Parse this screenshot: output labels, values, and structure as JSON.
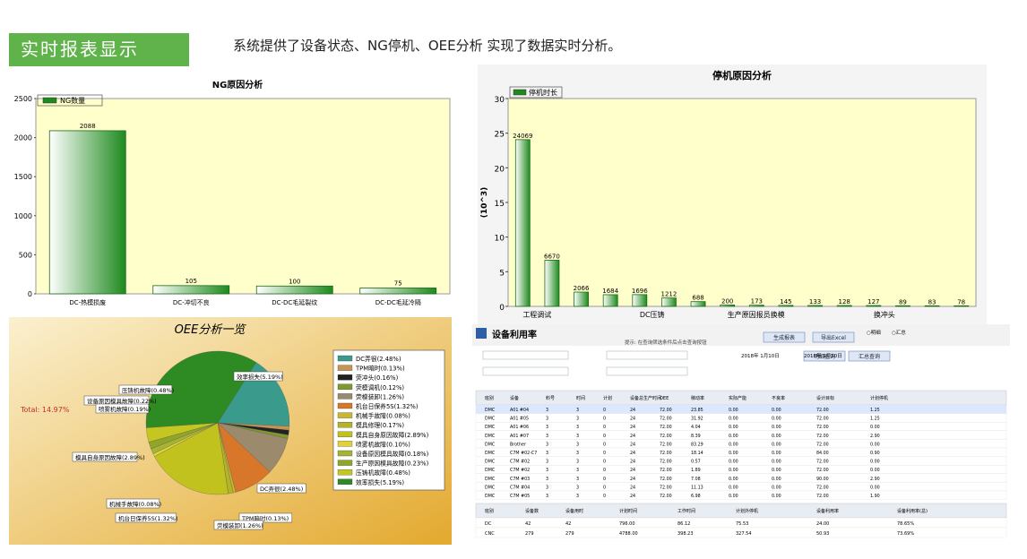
{
  "header": {
    "banner": "实时报表显示",
    "subtitle": "系统提供了设备状态、NG停机、OEE分析 实现了数据实时分析。"
  },
  "colors": {
    "banner": "#5fb34a",
    "bar_dark": "#1e8a1e",
    "bar_light": "#ffffff",
    "plot_bg": "#ffffcc",
    "oee_bg": "#e9c266"
  },
  "chart_data": [
    {
      "type": "bar",
      "title": "NG原因分析",
      "legend": [
        "NG数量"
      ],
      "categories": [
        "DC-热模损废",
        "DC-冲切不良",
        "DC-DC毛延裂纹",
        "DC-DC毛延冷隔"
      ],
      "values": [
        2088,
        105,
        100,
        75
      ],
      "ylim": [
        0,
        2500
      ],
      "yticks": [
        "0",
        "500",
        "1000",
        "1500",
        "2000",
        "2500"
      ],
      "grid": false
    },
    {
      "type": "bar",
      "title": "停机原因分析",
      "legend": [
        "停机时长"
      ],
      "ylabel": "(10^3)",
      "categories": [
        "工程调试",
        "",
        "",
        "",
        "DC压铸",
        "",
        "",
        "生产原因报员换模",
        "",
        "",
        "",
        "",
        "换冲头",
        "",
        "",
        ""
      ],
      "values": [
        24.069,
        6.67,
        2.066,
        1.684,
        1.696,
        1.212,
        0.688,
        0.2,
        0.173,
        0.145,
        0.133,
        0.128,
        0.127,
        0.089,
        0.083,
        0.078
      ],
      "data_labels": [
        "24069",
        "6670",
        "2066",
        "1684",
        "1696",
        "1212",
        "688",
        "200",
        "173",
        "145",
        "133",
        "128",
        "127",
        "89",
        "83",
        "78"
      ],
      "ylim": [
        0,
        30
      ],
      "yticks": [
        "0",
        "5",
        "10",
        "15",
        "20",
        "25",
        "30"
      ],
      "grid": false
    },
    {
      "type": "pie",
      "title": "OEE分析一览",
      "total_label": "Total: 14.97%",
      "slices": [
        {
          "name": "DC弄很",
          "label": "DC弄很(2.48%)",
          "value": 2.48,
          "color": "#3a9a8c"
        },
        {
          "name": "TPM暗时",
          "label": "TPM暗时(0.13%)",
          "value": 0.13,
          "color": "#c99450"
        },
        {
          "name": "荧冲头",
          "label": "荧冲头(0.16%)",
          "value": 0.16,
          "color": "#222222"
        },
        {
          "name": "荧模调机",
          "label": "荧模调机(0.12%)",
          "value": 0.12,
          "color": "#7d9a2a"
        },
        {
          "name": "荧模装卸",
          "label": "荧模装卸(1.26%)",
          "value": 1.26,
          "color": "#9c8a6c"
        },
        {
          "name": "机台日保养5S",
          "label": "机台日保养5S(1.32%)",
          "value": 1.32,
          "color": "#d8762a"
        },
        {
          "name": "机械手故障",
          "label": "机械手故障(0.08%)",
          "value": 0.08,
          "color": "#c8b830"
        },
        {
          "name": "模具修理",
          "label": "模具修理(0.17%)",
          "value": 0.17,
          "color": "#b3b32a"
        },
        {
          "name": "模具自身原因故障",
          "label": "模具自身原因故障(2.89%)",
          "value": 2.89,
          "color": "#c2c21e"
        },
        {
          "name": "喷雾机故障",
          "label": "喷雾机故障(0.10%)",
          "value": 0.1,
          "color": "#e2d23a"
        },
        {
          "name": "设备原因模具故障",
          "label": "设备原因模具故障(0.18%)",
          "value": 0.18,
          "color": "#a7b432"
        },
        {
          "name": "生产原因模具故障",
          "label": "生产原因模具故障(0.23%)",
          "value": 0.23,
          "color": "#8fa628"
        },
        {
          "name": "压铸机故障",
          "label": "压铸机故障(0.48%)",
          "value": 0.48,
          "color": "#c6c620"
        },
        {
          "name": "效率损失",
          "label": "效率损失(5.19%)",
          "value": 5.19,
          "color": "#2e8a22"
        }
      ],
      "callouts": [
        "效率损失(5.19%)",
        "压铸机故障(0.48%)",
        "设备原因模具故障(0.22%)",
        "喷雾机故障(0.19%)",
        "模具自身原因故障(2.89%)",
        "DC弄很(2.48%)",
        "TPM暗时(0.13%)",
        "机台日保养5S(1.32%)",
        "机械手故障(0.08%)",
        "荧模装卸(1.26%)"
      ]
    }
  ],
  "equipment": {
    "title": "设备利用率",
    "hint": "提示: 在查询筛选条件后点击查询按钮",
    "buttons": [
      "生成报表",
      "导出Excel",
      "明细查询",
      "汇总查询"
    ],
    "radio": [
      "明细",
      "汇总"
    ],
    "filter_labels": [
      "日",
      "设备名",
      "开始日期",
      "到",
      "料号",
      "料号类型"
    ],
    "date_start": "2018年 1月10日",
    "date_end": "2018年 1月10日",
    "columns": [
      "班别",
      "设备",
      "料号",
      "时间",
      "计划",
      "设备总生产时间",
      "OEE",
      "稼动率",
      "实际产能",
      "不良率",
      "设计目标",
      "计划停机"
    ],
    "rows": [
      [
        "DMC",
        "A01 #04",
        "3",
        "3",
        "0",
        "24",
        "72.00",
        "23.85",
        "0.00",
        "0.00",
        "72.00",
        "1.25"
      ],
      [
        "DMC",
        "A01 #05",
        "3",
        "3",
        "0",
        "24",
        "72.00",
        "31.92",
        "0.00",
        "0.00",
        "72.00",
        "1.25"
      ],
      [
        "DMC",
        "A01 #06",
        "3",
        "3",
        "0",
        "24",
        "72.00",
        "4.04",
        "0.00",
        "0.00",
        "72.00",
        "0.00"
      ],
      [
        "DMC",
        "A01 #07",
        "3",
        "3",
        "0",
        "24",
        "72.00",
        "8.39",
        "0.00",
        "0.00",
        "72.00",
        "2.90"
      ],
      [
        "DMC",
        "Brother",
        "3",
        "3",
        "0",
        "24",
        "72.00",
        "83.29",
        "0.00",
        "0.00",
        "72.00",
        "0.00"
      ],
      [
        "DMC",
        "C7M #02-C7",
        "3",
        "3",
        "0",
        "24",
        "72.00",
        "18.14",
        "0.00",
        "0.00",
        "84.00",
        "0.90"
      ],
      [
        "DMC",
        "C7M #02",
        "3",
        "3",
        "0",
        "24",
        "72.00",
        "0.57",
        "0.00",
        "0.00",
        "72.00",
        "0.00"
      ],
      [
        "DMC",
        "C7M #02",
        "3",
        "3",
        "0",
        "24",
        "72.00",
        "1.89",
        "0.00",
        "0.00",
        "72.00",
        "0.00"
      ],
      [
        "DMC",
        "C7M #03",
        "3",
        "3",
        "0",
        "24",
        "72.00",
        "7.08",
        "0.00",
        "0.00",
        "90.00",
        "2.90"
      ],
      [
        "DMC",
        "C7M #04",
        "3",
        "3",
        "0",
        "24",
        "72.00",
        "11.13",
        "0.00",
        "0.00",
        "72.00",
        "0.00"
      ],
      [
        "DMC",
        "C7M #05",
        "3",
        "3",
        "0",
        "24",
        "72.00",
        "6.98",
        "0.00",
        "0.00",
        "72.00",
        "1.90"
      ]
    ],
    "summary_columns": [
      "班别",
      "设备数",
      "设备用时",
      "计划时间",
      "工作时间",
      "计划外停机",
      "设备利用率",
      "设备利用率(总)"
    ],
    "summary_rows": [
      [
        "DC",
        "42",
        "42",
        "796.00",
        "86.12",
        "75.53",
        "24.00",
        "78.65%"
      ],
      [
        "CNC",
        "279",
        "279",
        "4788.00",
        "398.23",
        "327.54",
        "50.93",
        "73.69%"
      ]
    ]
  }
}
